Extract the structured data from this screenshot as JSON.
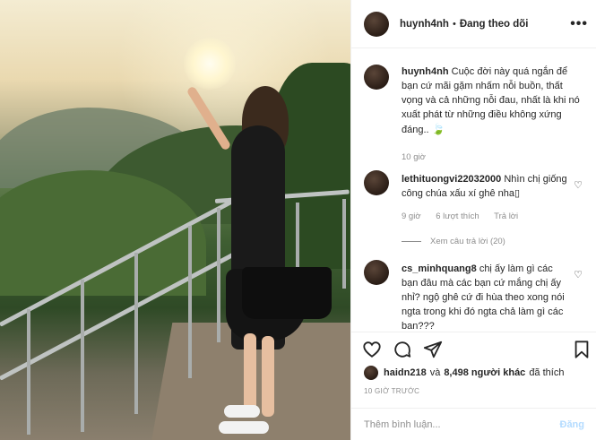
{
  "header": {
    "username": "huynh4nh",
    "separator": "•",
    "follow_status": "Đang theo dõi",
    "more_label": "•••"
  },
  "caption": {
    "username": "huynh4nh",
    "text": "Cuộc đời này quá ngắn để bạn cứ mãi gặm nhấm nỗi buồn, thất vọng và cả những nỗi đau, nhất là khi nó xuất phát từ những điều không xứng đáng..",
    "time": "10 giờ"
  },
  "comments": [
    {
      "username": "lethituongvi22032000",
      "text": "Nhìn chị giống công chúa xấu xí ghê nha",
      "time": "9 giờ",
      "likes": "6 lượt thích",
      "reply_label": "Trả lời",
      "view_replies": "Xem câu trả lời (20)"
    },
    {
      "username": "cs_minhquang8",
      "text": "chị ấy làm gì các bạn đâu mà các bạn cứ mắng chị ấy nhỉ? ngộ ghê cứ đi hùa theo xong nói ngta trong khi đó ngta chả làm gì các bạn???"
    }
  ],
  "likes": {
    "liker": "haidn218",
    "conjunction": "và",
    "others": "8,498 người khác",
    "suffix": "đã thích"
  },
  "timestamp": "10 GIỜ TRƯỚC",
  "add_comment": {
    "placeholder": "Thêm bình luận...",
    "post_label": "Đăng"
  },
  "icons": {
    "heart": "heart-icon",
    "comment": "comment-icon",
    "share": "share-icon",
    "save": "bookmark-icon"
  },
  "colors": {
    "text": "#262626",
    "muted": "#8e8e8e",
    "post_button": "#b3dbff",
    "border": "#efefef"
  }
}
